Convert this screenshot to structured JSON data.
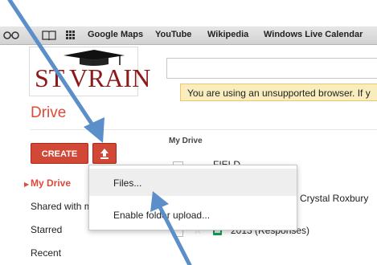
{
  "bookmarks": {
    "items": [
      "Google Maps",
      "YouTube",
      "Wikipedia",
      "Windows Live Calendar"
    ]
  },
  "logo": {
    "text": "ST.VRAIN"
  },
  "warning": {
    "text": "You are using an unsupported browser. If y"
  },
  "drive": {
    "title": "Drive"
  },
  "toolbar": {
    "create_label": "CREATE"
  },
  "file_list": {
    "header": "My Drive",
    "rows": [
      {
        "title": "FIELD..."
      },
      {
        "title": "Crystal Roxbury"
      },
      {
        "title": "2013 (Responses)"
      }
    ]
  },
  "sidebar": {
    "items": [
      {
        "label": "My Drive",
        "active": true
      },
      {
        "label": "Shared with me"
      },
      {
        "label": "Starred"
      },
      {
        "label": "Recent"
      }
    ]
  },
  "upload_menu": {
    "items": [
      {
        "label": "Files..."
      },
      {
        "label": "Enable folder upload..."
      }
    ]
  },
  "colors": {
    "accent": "#dd4b39",
    "create_button": "#d14836",
    "annotation_arrow": "#5b8fc9",
    "warning_bg": "#f9edbe"
  },
  "icons": [
    "reading-glasses-icon",
    "bookmarks-book-icon",
    "apps-grid-icon",
    "upload-icon",
    "star-icon",
    "spreadsheet-icon",
    "graduation-cap-icon"
  ]
}
